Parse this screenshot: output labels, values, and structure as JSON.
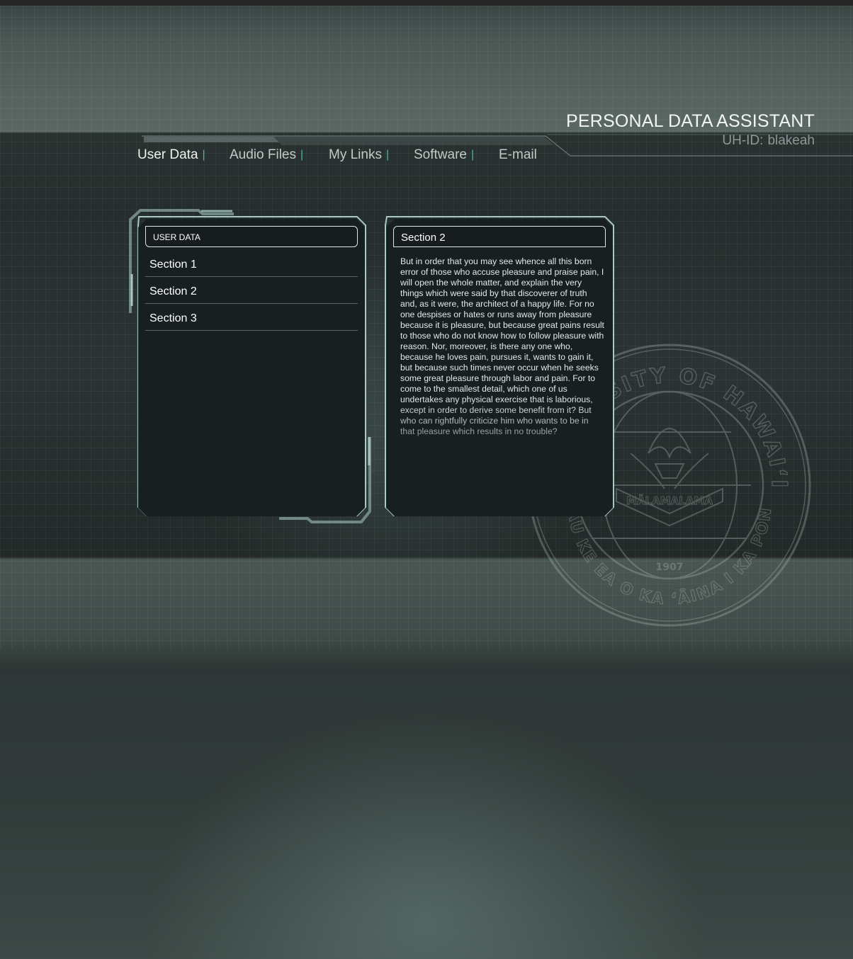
{
  "header": {
    "app_title": "PERSONAL DATA ASSISTANT",
    "user_id_label": "UH-ID:",
    "user_id_value": "blakeah"
  },
  "nav": {
    "items": [
      {
        "label": "User Data",
        "active": true
      },
      {
        "label": "Audio Files",
        "active": false
      },
      {
        "label": "My Links",
        "active": false
      },
      {
        "label": "Software",
        "active": false
      },
      {
        "label": "E-mail",
        "active": false
      }
    ],
    "separator": "|"
  },
  "left_panel": {
    "title": "USER DATA",
    "sections": [
      {
        "label": "Section 1"
      },
      {
        "label": "Section 2"
      },
      {
        "label": "Section 3"
      }
    ]
  },
  "right_panel": {
    "title": "Section 2",
    "body": "But in order that you may see whence all this born error of those who accuse pleasure and praise pain, I will open the whole matter, and explain the very things which were said by that discoverer of truth and, as it were, the architect of a happy life. For no one despises or hates or runs away from pleasure because it is pleasure, but because great pains result to those who do not know how to follow pleasure with reason. Nor, moreover, is there any one who, because he loves pain, pursues it, wants to gain it, but because such times never occur when he seeks some great pleasure through labor and pain. For to come to the smallest detail, which one of us undertakes any physical exercise that is laborious, except in order to derive some benefit from it? But who can rightfully criticize him who wants to be in that pleasure which results in no trouble?"
  },
  "seal": {
    "top_text": "UNIVERSITY OF HAWAIʻI",
    "bottom_text": "MAU KE EA O KA ʻĀINA I KA PONO",
    "motto": "MĀLAMALAMA",
    "year": "1907"
  },
  "colors": {
    "accent": "#48b4a8",
    "panel_bg": "#181f21",
    "frame": "#a9c9c4"
  }
}
